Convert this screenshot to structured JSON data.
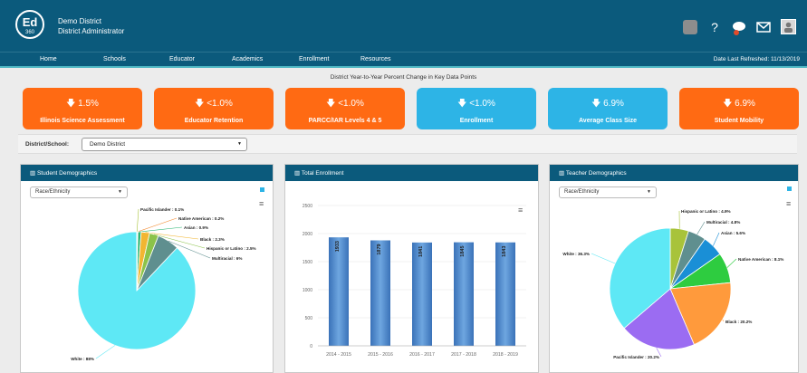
{
  "header": {
    "logo_text": "Ed",
    "logo_sub": "360",
    "district_name": "Demo District",
    "role": "District Administrator",
    "icons": [
      "grey-square-icon",
      "help-icon",
      "chat-icon",
      "mail-icon",
      "user-avatar-icon"
    ]
  },
  "nav": {
    "items": [
      "Home",
      "Schools",
      "Educator",
      "Academics",
      "Enrollment",
      "Resources"
    ],
    "last_refreshed": "Date Last Refreshed: 11/13/2019"
  },
  "kpi": {
    "title": "District Year-to-Year Percent Change in Key Data Points",
    "cards": [
      {
        "value": "1.5%",
        "label": "Illinois Science Assessment",
        "color": "#ff6a13"
      },
      {
        "value": "<1.0%",
        "label": "Educator Retention",
        "color": "#ff6a13"
      },
      {
        "value": "<1.0%",
        "label": "PARCC/IAR Levels 4 & 5",
        "color": "#ff6a13"
      },
      {
        "value": "<1.0%",
        "label": "Enrollment",
        "color": "#2db4e6"
      },
      {
        "value": "6.9%",
        "label": "Average Class Size",
        "color": "#2db4e6"
      },
      {
        "value": "6.9%",
        "label": "Student Mobility",
        "color": "#ff6a13"
      }
    ]
  },
  "filter": {
    "label": "District/School:",
    "value": "Demo District"
  },
  "panels": {
    "student": {
      "title": "Student Demographics",
      "select": "Race/Ethnicity"
    },
    "enrollment": {
      "title": "Total Enrollment"
    },
    "teacher": {
      "title": "Teacher Demographics",
      "select": "Race/Ethnicity"
    }
  },
  "chart_data": [
    {
      "type": "pie",
      "title": "",
      "labels": [
        "White",
        "Pacific Islander",
        "Native American",
        "Asian",
        "Black",
        "Hispanic or Latino",
        "Multiracial"
      ],
      "values": [
        88,
        0.1,
        0.2,
        0.9,
        2.3,
        2.5,
        6
      ],
      "label_texts": [
        "White : 88%",
        "Pacific Islander : 0.1%",
        "Native American : 0.2%",
        "Asian : 0.9%",
        "Black : 2.3%",
        "Hispanic or Latino : 2.5%",
        "Multiracial : 6%"
      ],
      "colors": [
        "#5ee8f5",
        "#a8c33a",
        "#f28a30",
        "#2bb673",
        "#f2b632",
        "#8bc34a",
        "#5f8f8f"
      ]
    },
    {
      "type": "bar",
      "title": "",
      "categories": [
        "2014 - 2015",
        "2015 - 2016",
        "2016 - 2017",
        "2017 - 2018",
        "2018 - 2019"
      ],
      "values": [
        1933,
        1879,
        1841,
        1845,
        1843
      ],
      "ylim": [
        0,
        2500
      ],
      "yticks": [
        "0",
        "500",
        "1000",
        "1500",
        "2000",
        "2500"
      ],
      "bar_color": "#4a86c8"
    },
    {
      "type": "pie",
      "title": "",
      "labels": [
        "Hispanic or Latino",
        "Multiracial",
        "Asian",
        "Native American",
        "Black",
        "Pacific Islander",
        "White"
      ],
      "values": [
        4.9,
        4.8,
        5.6,
        8.1,
        20.2,
        20.2,
        36.3
      ],
      "label_texts": [
        "Hispanic or Latino : 4.9%",
        "Multiracial : 4.8%",
        "Asian : 5.6%",
        "Native American : 8.1%",
        "Black : 20.2%",
        "Pacific Islander : 20.2%",
        "White : 36.3%"
      ],
      "colors": [
        "#a8c33a",
        "#5f8f8f",
        "#1a8fd6",
        "#2ecc40",
        "#ff9a3c",
        "#9b6cf2",
        "#5ee8f5"
      ]
    }
  ]
}
